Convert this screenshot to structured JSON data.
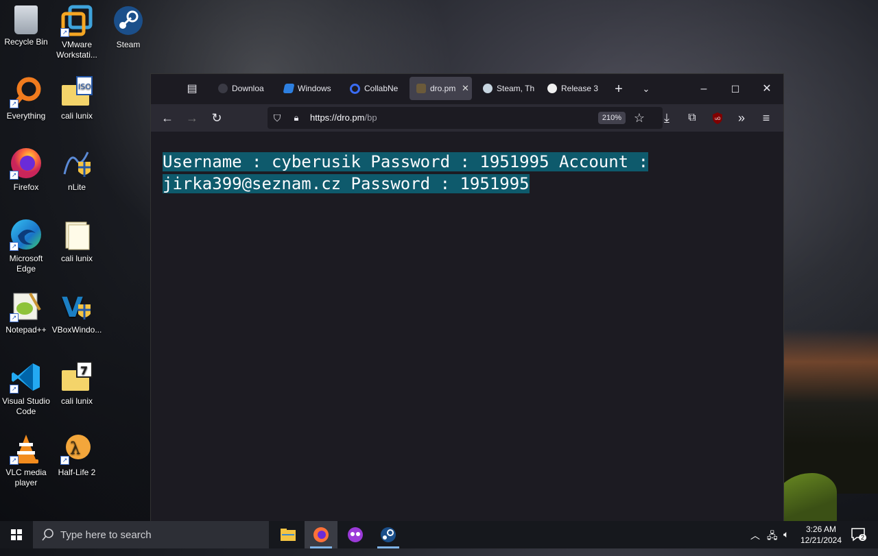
{
  "desktop": {
    "icons": [
      {
        "label": "Recycle Bin",
        "icon": "recycle-bin-icon"
      },
      {
        "label": "VMware Workstati...",
        "icon": "vmware-icon"
      },
      {
        "label": "Steam",
        "icon": "steam-icon"
      },
      {
        "label": "Everything",
        "icon": "everything-search-icon"
      },
      {
        "label": "cali lunix",
        "icon": "iso-folder-icon"
      },
      {
        "label": "Firefox",
        "icon": "firefox-icon"
      },
      {
        "label": "nLite",
        "icon": "nlite-icon"
      },
      {
        "label": "Microsoft Edge",
        "icon": "edge-icon"
      },
      {
        "label": "cali lunix",
        "icon": "file-icon"
      },
      {
        "label": "Notepad++",
        "icon": "notepadpp-icon"
      },
      {
        "label": "VBoxWindo...",
        "icon": "vbox-icon"
      },
      {
        "label": "Visual Studio Code",
        "icon": "vscode-icon"
      },
      {
        "label": "cali lunix",
        "icon": "7z-folder-icon"
      },
      {
        "label": "VLC media player",
        "icon": "vlc-icon"
      },
      {
        "label": "Half-Life 2",
        "icon": "halflife-icon"
      }
    ]
  },
  "browser": {
    "tabs": [
      {
        "title": "Downloa",
        "icon": "download-icon"
      },
      {
        "title": "Windows",
        "icon": "windows-icon"
      },
      {
        "title": "CollabNe",
        "icon": "search-icon"
      },
      {
        "title": "dro.pm",
        "icon": "dropm-icon",
        "active": true
      },
      {
        "title": "Steam, Th",
        "icon": "steam-icon"
      },
      {
        "title": "Release 3",
        "icon": "github-icon"
      }
    ],
    "url_host": "https://dro.pm",
    "url_path": "/bp",
    "zoom": "210%",
    "page_text": "Username : cyberusik Password : 1951995 Account : jirka399@seznam.cz Password : 1951995"
  },
  "taskbar": {
    "search_placeholder": "Type here to search",
    "time": "3:26 AM",
    "date": "12/21/2024",
    "notifications": "2"
  },
  "colors": {
    "selection": "#0e5a6c",
    "tab_active": "#42414d",
    "toolbar": "#2b2a33",
    "content_bg": "#1c1b22"
  }
}
